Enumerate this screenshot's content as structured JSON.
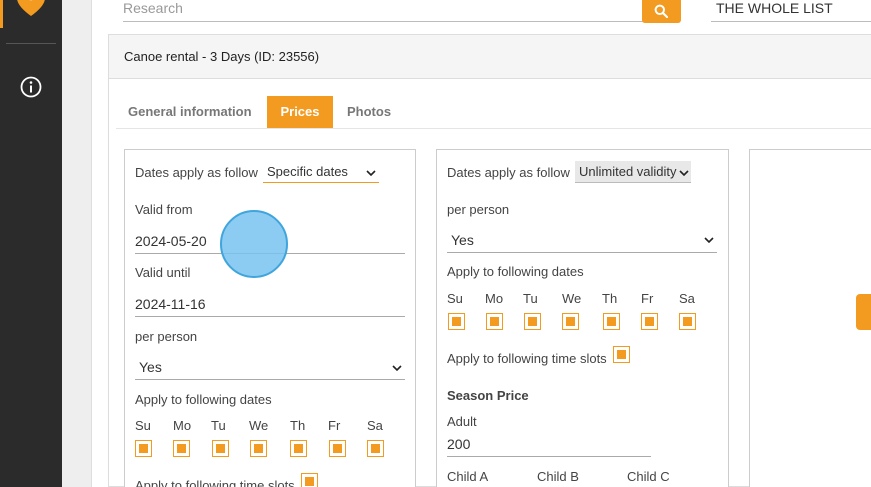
{
  "search": {
    "placeholder": "Research",
    "list_value": "THE WHOLE LIST"
  },
  "item": {
    "title": "Canoe rental - 3 Days (ID: 23556)"
  },
  "tabs": [
    {
      "label": "General information"
    },
    {
      "label": "Prices"
    },
    {
      "label": "Photos"
    }
  ],
  "days": [
    "Su",
    "Mo",
    "Tu",
    "We",
    "Th",
    "Fr",
    "Sa"
  ],
  "price1": {
    "dates_apply_label": "Dates apply as follow",
    "dates_apply_value": "Specific dates",
    "valid_from_label": "Valid from",
    "valid_from_value": "2024-05-20",
    "valid_until_label": "Valid until",
    "valid_until_value": "2024-11-16",
    "per_person_label": "per person",
    "per_person_value": "Yes",
    "apply_dates_label": "Apply to following dates",
    "apply_slots_label": "Apply to following time slots"
  },
  "price2": {
    "dates_apply_label": "Dates apply as follow",
    "dates_apply_value": "Unlimited validity",
    "per_person_label": "per person",
    "per_person_value": "Yes",
    "apply_dates_label": "Apply to following dates",
    "apply_slots_label": "Apply to following time slots",
    "season_price_label": "Season Price",
    "adult_label": "Adult",
    "adult_value": "200",
    "child_a_label": "Child A",
    "child_b_label": "Child B",
    "child_c_label": "Child C"
  },
  "colors": {
    "accent": "#f39a21",
    "sidebar": "#2b2b2b"
  },
  "icons": [
    "location-pin-icon",
    "info-icon",
    "search-icon",
    "chevron-down-icon"
  ]
}
